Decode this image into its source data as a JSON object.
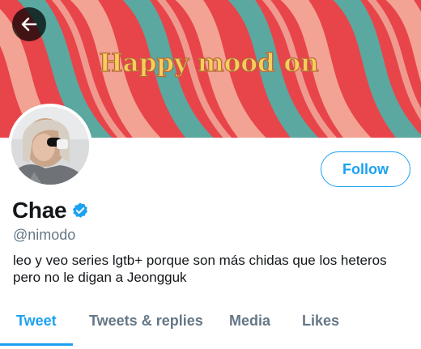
{
  "header": {
    "banner_text": "Happy mood on",
    "back_icon": "arrow-left-icon"
  },
  "profile": {
    "display_name": "Chae",
    "handle": "@nimodo",
    "verified": true,
    "bio_line1": "leo y veo series lgtb+ porque son más chidas que los heteros",
    "bio_line2": "pero no le digan a Jeongguk"
  },
  "actions": {
    "follow_label": "Follow"
  },
  "tabs": [
    {
      "label": "Tweet",
      "active": true
    },
    {
      "label": "Tweets & replies",
      "active": false
    },
    {
      "label": "Media",
      "active": false
    },
    {
      "label": "Likes",
      "active": false
    }
  ],
  "colors": {
    "accent": "#1da1f2",
    "banner_red": "#e8454b",
    "banner_pink": "#f3a393",
    "banner_teal": "#5aa8a0",
    "banner_text": "#f6cf5b"
  }
}
